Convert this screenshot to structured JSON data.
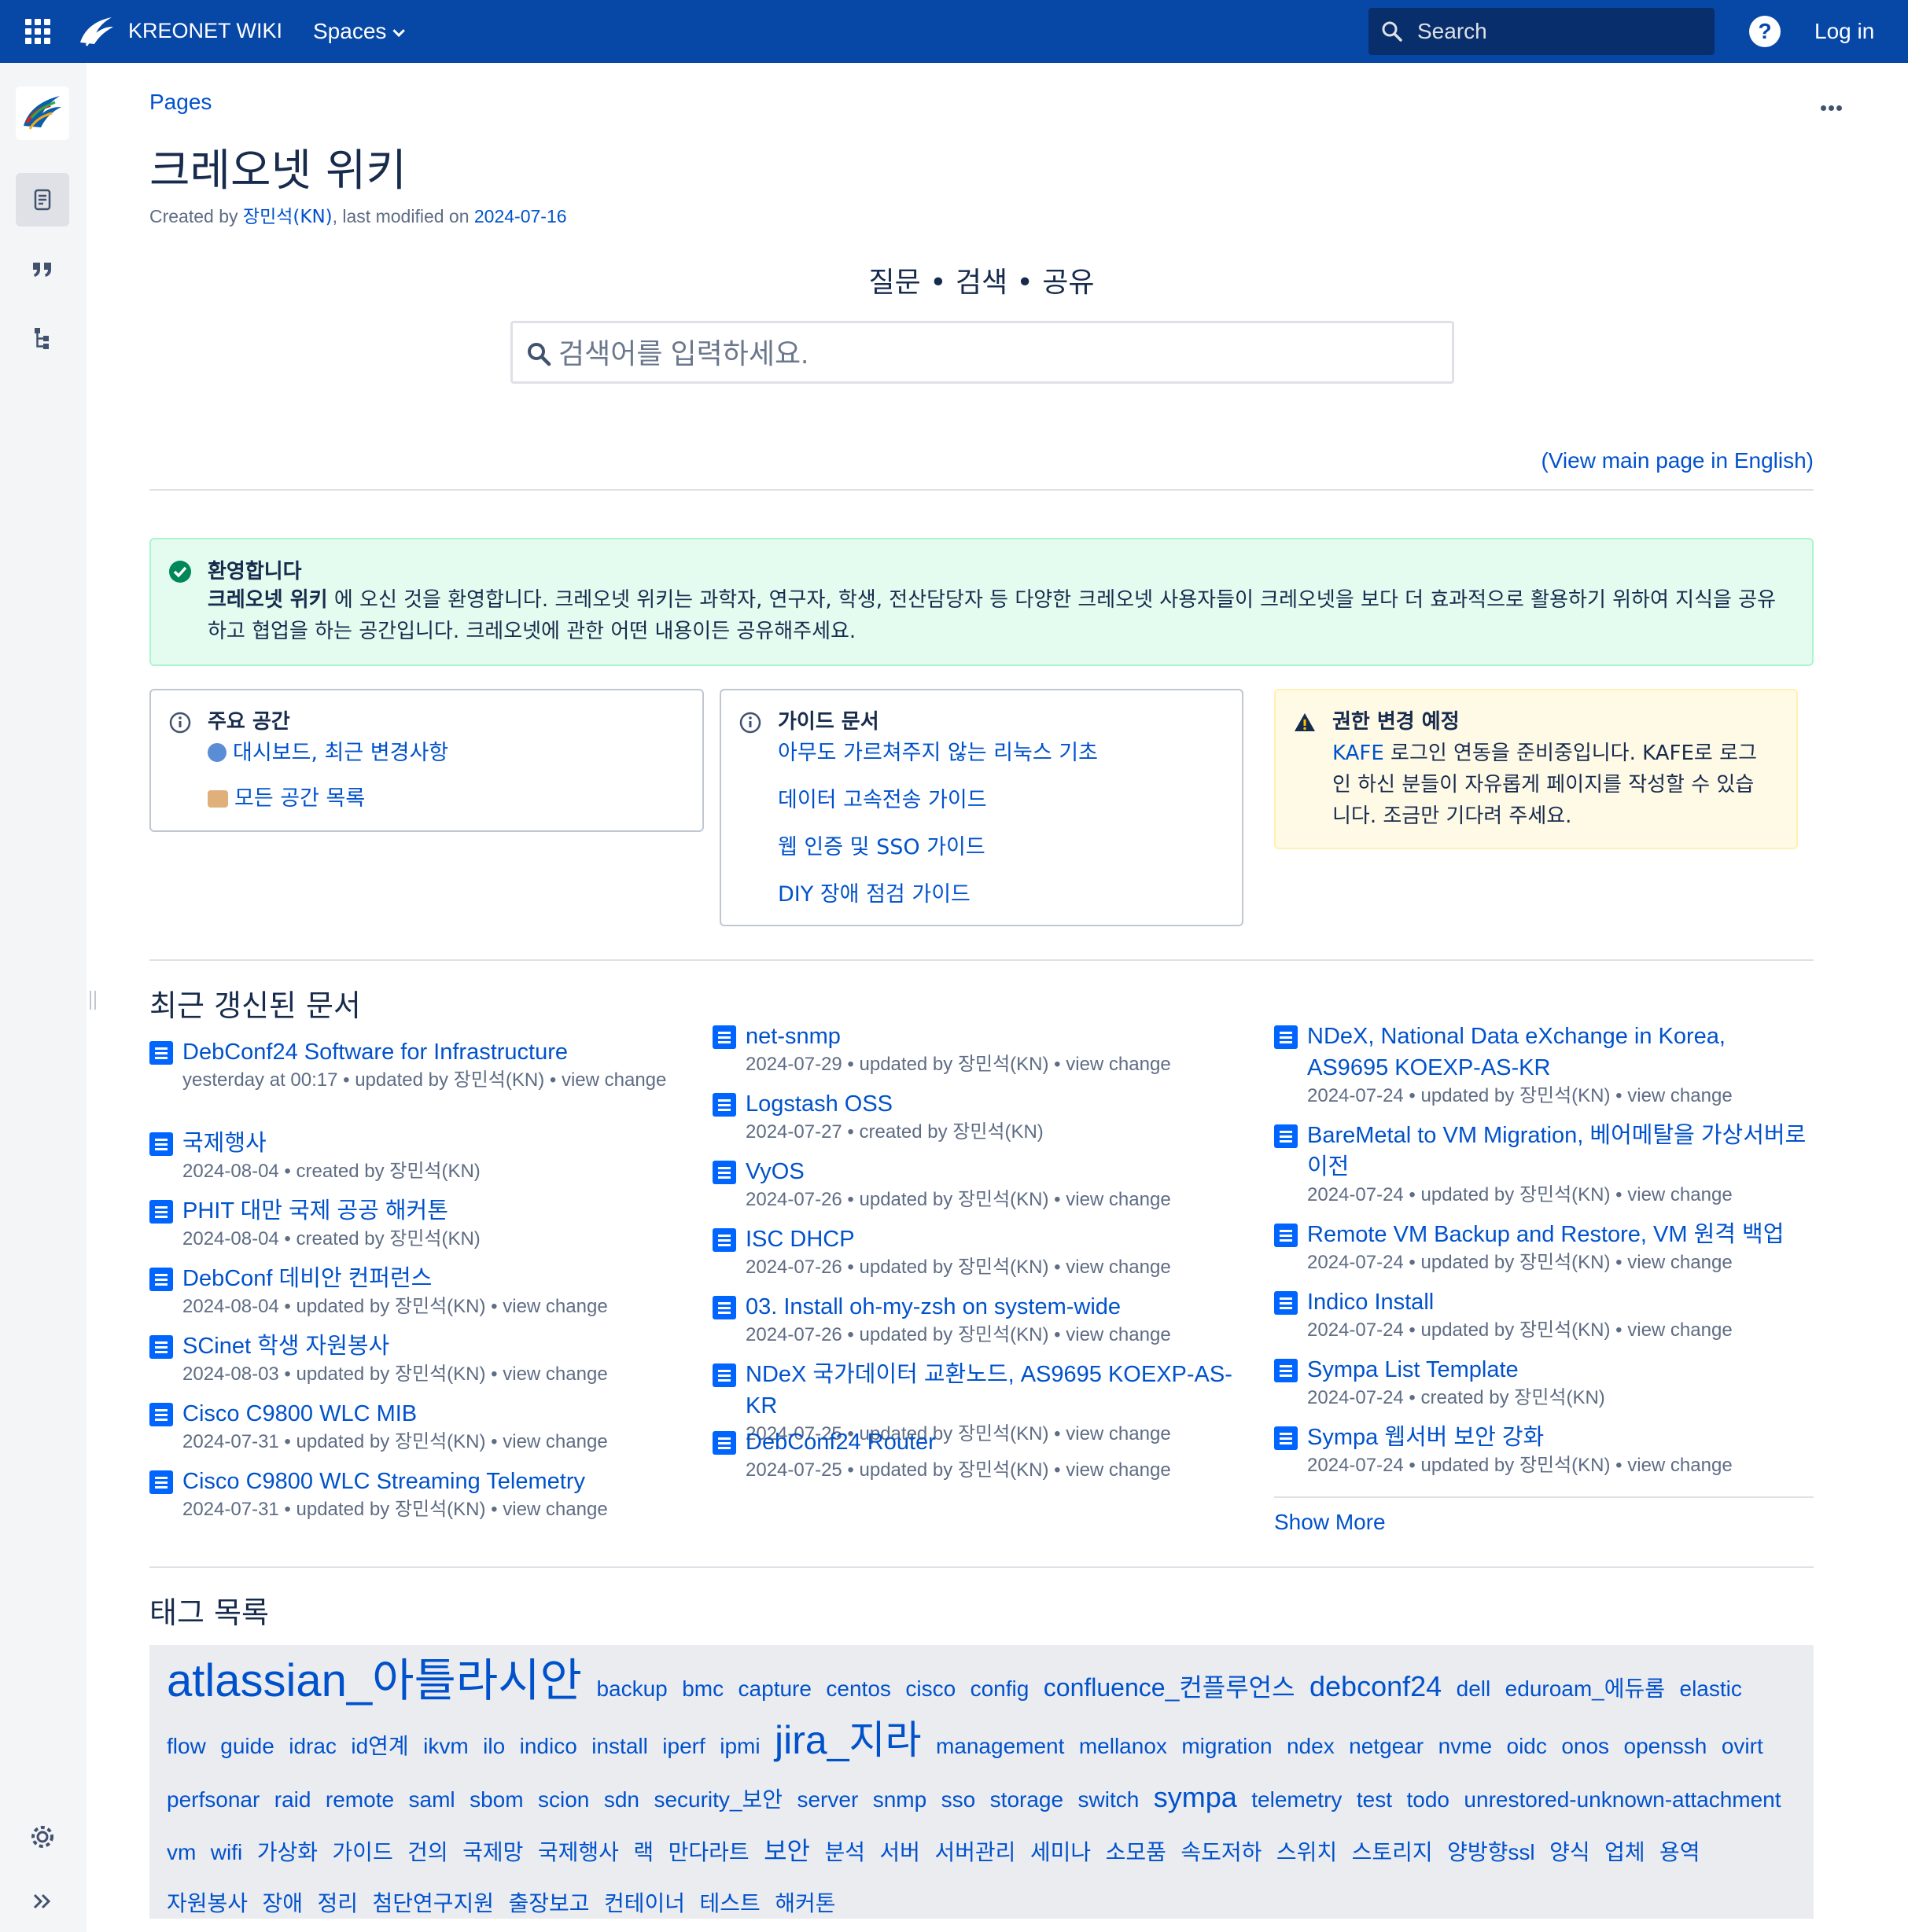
{
  "topbar": {
    "brand": "KREONET WIKI",
    "spaces_label": "Spaces",
    "search_placeholder": "Search",
    "help_label": "?",
    "login_label": "Log in",
    "bg_color": "#0747a6"
  },
  "page": {
    "breadcrumb": "Pages",
    "title": "크레오넷 위키",
    "byline_created": "Created by ",
    "byline_author": "장민석(KN)",
    "byline_modified": ", last modified on ",
    "byline_date": "2024-07-16",
    "tagline": "질문 • 검색 • 공유",
    "search_placeholder": "검색어를 입력하세요.",
    "view_english": "(View main page in English)"
  },
  "welcome": {
    "title": "환영합니다",
    "bold": "크레오넷 위키",
    "text": " 에 오신 것을 환영합니다. 크레오넷 위키는 과학자, 연구자, 학생, 전산담당자 등 다양한 크레오넷 사용자들이 크레오넷을 보다 더 효과적으로 활용하기 위하여 지식을 공유하고 협업을 하는 공간입니다. 크레오넷에 관한 어떤 내용이든 공유해주세요."
  },
  "main_spaces": {
    "title": "주요 공간",
    "links": [
      "대시보드, 최근 변경사항",
      "모든 공간 목록"
    ]
  },
  "guides": {
    "title": "가이드 문서",
    "links": [
      "아무도 가르쳐주지 않는 리눅스 기초",
      "데이터 고속전송 가이드",
      "웹 인증 및 SSO 가이드",
      "DIY 장애 점검 가이드"
    ]
  },
  "notice": {
    "title": "권한 변경 예정",
    "link": "KAFE",
    "text": " 로그인 연동을 준비중입니다. KAFE로 로그인 하신 분들이 자유롭게 페이지를 작성할 수 있습니다. 조금만 기다려 주세요."
  },
  "recent": {
    "title": "최근 갱신된 문서",
    "show_more": "Show More",
    "columns": [
      [
        {
          "title": "DebConf24 Software for Infrastructure",
          "meta": "yesterday at 00:17 • updated by 장민석(KN) • view change"
        },
        {
          "title": "국제행사",
          "meta": "2024-08-04 • created by 장민석(KN)"
        },
        {
          "title": "PHIT 대만 국제 공공 해커톤",
          "meta": "2024-08-04 • created by 장민석(KN)"
        },
        {
          "title": "DebConf 데비안 컨퍼런스",
          "meta": "2024-08-04 • updated by 장민석(KN) • view change"
        },
        {
          "title": "SCinet 학생 자원봉사",
          "meta": "2024-08-03 • updated by 장민석(KN) • view change"
        },
        {
          "title": "Cisco C9800 WLC MIB",
          "meta": "2024-07-31 • updated by 장민석(KN) • view change"
        },
        {
          "title": "Cisco C9800 WLC Streaming Telemetry",
          "meta": "2024-07-31 • updated by 장민석(KN) • view change"
        }
      ],
      [
        {
          "title": "net-snmp",
          "meta": "2024-07-29 • updated by 장민석(KN) • view change"
        },
        {
          "title": "Logstash OSS",
          "meta": "2024-07-27 • created by 장민석(KN)"
        },
        {
          "title": "VyOS",
          "meta": "2024-07-26 • updated by 장민석(KN) • view change"
        },
        {
          "title": "ISC DHCP",
          "meta": "2024-07-26 • updated by 장민석(KN) • view change"
        },
        {
          "title": "03. Install oh-my-zsh on system-wide",
          "meta": "2024-07-26 • updated by 장민석(KN) • view change"
        },
        {
          "title": "NDeX 국가데이터 교환노드, AS9695 KOEXP-AS-KR",
          "meta": "2024-07-25 • updated by 장민석(KN) • view change"
        },
        {
          "title": "DebConf24 Router",
          "meta": "2024-07-25 • updated by 장민석(KN) • view change"
        }
      ],
      [
        {
          "title": "NDeX, National Data eXchange in Korea, AS9695 KOEXP-AS-KR",
          "meta": "2024-07-24 • updated by 장민석(KN) • view change"
        },
        {
          "title": "BareMetal to VM Migration, 베어메탈을 가상서버로 이전",
          "meta": "2024-07-24 • updated by 장민석(KN) • view change"
        },
        {
          "title": "Remote VM Backup and Restore, VM 원격 백업",
          "meta": "2024-07-24 • updated by 장민석(KN) • view change"
        },
        {
          "title": "Indico Install",
          "meta": "2024-07-24 • updated by 장민석(KN) • view change"
        },
        {
          "title": "Sympa List Template",
          "meta": "2024-07-24 • created by 장민석(KN)"
        },
        {
          "title": "Sympa 웹서버 보안 강화",
          "meta": "2024-07-24 • updated by 장민석(KN) • view change"
        }
      ]
    ]
  },
  "tags": {
    "title": "태그 목록",
    "items": [
      {
        "t": "atlassian_아틀라시안",
        "s": 5
      },
      {
        "t": "backup",
        "s": 1
      },
      {
        "t": "bmc",
        "s": 1
      },
      {
        "t": "capture",
        "s": 1
      },
      {
        "t": "centos",
        "s": 1
      },
      {
        "t": "cisco",
        "s": 1
      },
      {
        "t": "config",
        "s": 1
      },
      {
        "t": "confluence_컨플루언스",
        "s": 2
      },
      {
        "t": "debconf24",
        "s": 3
      },
      {
        "t": "dell",
        "s": 1
      },
      {
        "t": "eduroam_에듀롬",
        "s": 1
      },
      {
        "t": "elastic",
        "s": 1
      },
      {
        "t": "flow",
        "s": 1
      },
      {
        "t": "guide",
        "s": 1
      },
      {
        "t": "idrac",
        "s": 1
      },
      {
        "t": "id연계",
        "s": 1
      },
      {
        "t": "ikvm",
        "s": 1
      },
      {
        "t": "ilo",
        "s": 1
      },
      {
        "t": "indico",
        "s": 1
      },
      {
        "t": "install",
        "s": 1
      },
      {
        "t": "iperf",
        "s": 1
      },
      {
        "t": "ipmi",
        "s": 1
      },
      {
        "t": "jira_지라",
        "s": 4
      },
      {
        "t": "management",
        "s": 1
      },
      {
        "t": "mellanox",
        "s": 1
      },
      {
        "t": "migration",
        "s": 1
      },
      {
        "t": "ndex",
        "s": 1
      },
      {
        "t": "netgear",
        "s": 1
      },
      {
        "t": "nvme",
        "s": 1
      },
      {
        "t": "oidc",
        "s": 1
      },
      {
        "t": "onos",
        "s": 1
      },
      {
        "t": "openssh",
        "s": 1
      },
      {
        "t": "ovirt",
        "s": 1
      },
      {
        "t": "perfsonar",
        "s": 1
      },
      {
        "t": "raid",
        "s": 1
      },
      {
        "t": "remote",
        "s": 1
      },
      {
        "t": "saml",
        "s": 1
      },
      {
        "t": "sbom",
        "s": 1
      },
      {
        "t": "scion",
        "s": 1
      },
      {
        "t": "sdn",
        "s": 1
      },
      {
        "t": "security_보안",
        "s": 1
      },
      {
        "t": "server",
        "s": 1
      },
      {
        "t": "snmp",
        "s": 1
      },
      {
        "t": "sso",
        "s": 1
      },
      {
        "t": "storage",
        "s": 1
      },
      {
        "t": "switch",
        "s": 1
      },
      {
        "t": "sympa",
        "s": 3
      },
      {
        "t": "telemetry",
        "s": 1
      },
      {
        "t": "test",
        "s": 1
      },
      {
        "t": "todo",
        "s": 1
      },
      {
        "t": "unrestored-unknown-attachment",
        "s": 1
      },
      {
        "t": "vm",
        "s": 1
      },
      {
        "t": "wifi",
        "s": 1
      },
      {
        "t": "가상화",
        "s": 1
      },
      {
        "t": "가이드",
        "s": 1
      },
      {
        "t": "건의",
        "s": 1
      },
      {
        "t": "국제망",
        "s": 1
      },
      {
        "t": "국제행사",
        "s": 1
      },
      {
        "t": "랙",
        "s": 1
      },
      {
        "t": "만다라트",
        "s": 1
      },
      {
        "t": "보안",
        "s": 2
      },
      {
        "t": "분석",
        "s": 1
      },
      {
        "t": "서버",
        "s": 1
      },
      {
        "t": "서버관리",
        "s": 1
      },
      {
        "t": "세미나",
        "s": 1
      },
      {
        "t": "소모품",
        "s": 1
      },
      {
        "t": "속도저하",
        "s": 1
      },
      {
        "t": "스위치",
        "s": 1
      },
      {
        "t": "스토리지",
        "s": 1
      },
      {
        "t": "양방향ssl",
        "s": 1
      },
      {
        "t": "양식",
        "s": 1
      },
      {
        "t": "업체",
        "s": 1
      },
      {
        "t": "용역",
        "s": 1
      },
      {
        "t": "자원봉사",
        "s": 1
      },
      {
        "t": "장애",
        "s": 1
      },
      {
        "t": "정리",
        "s": 1
      },
      {
        "t": "첨단연구지원",
        "s": 1
      },
      {
        "t": "출장보고",
        "s": 1
      },
      {
        "t": "컨테이너",
        "s": 1
      },
      {
        "t": "테스트",
        "s": 1
      },
      {
        "t": "해커톤",
        "s": 1
      }
    ]
  }
}
